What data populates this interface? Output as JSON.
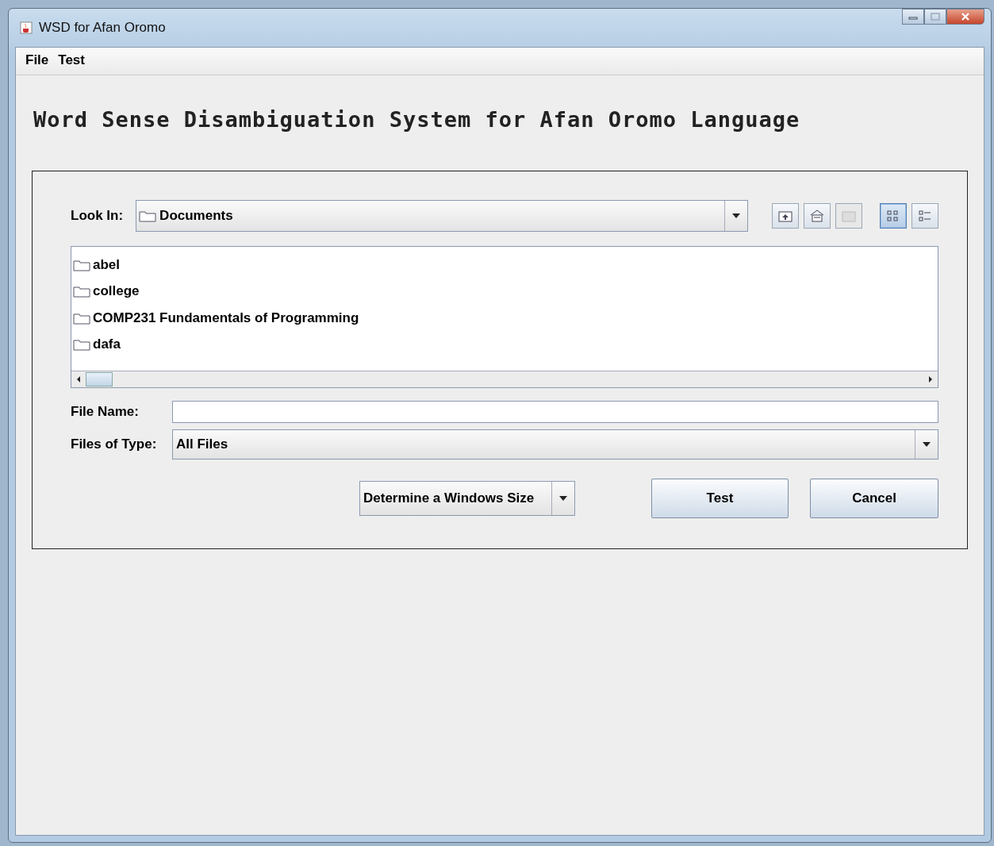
{
  "window": {
    "title": "WSD for Afan Oromo"
  },
  "menu": [
    "File",
    "Test"
  ],
  "heading": "Word Sense Disambiguation System for Afan Oromo Language",
  "chooser": {
    "look_in_label": "Look In:",
    "look_in_value": "Documents",
    "toolbar": [
      {
        "kind": "up",
        "disabled": false,
        "selected": false
      },
      {
        "kind": "home",
        "disabled": false,
        "selected": false
      },
      {
        "kind": "newfolder",
        "disabled": true,
        "selected": false
      },
      {
        "kind": "list",
        "disabled": false,
        "selected": true
      },
      {
        "kind": "details",
        "disabled": false,
        "selected": false
      }
    ],
    "files": [
      {
        "name": "abel"
      },
      {
        "name": "college"
      },
      {
        "name": "COMP231 Fundamentals of  Programming"
      },
      {
        "name": "dafa"
      }
    ],
    "file_name_label": "File Name:",
    "file_types_label": "Files of Type:",
    "file_type_value": "All Files"
  },
  "size_combo": "Determine a Windows Size",
  "buttons": [
    "Test",
    "Cancel"
  ]
}
